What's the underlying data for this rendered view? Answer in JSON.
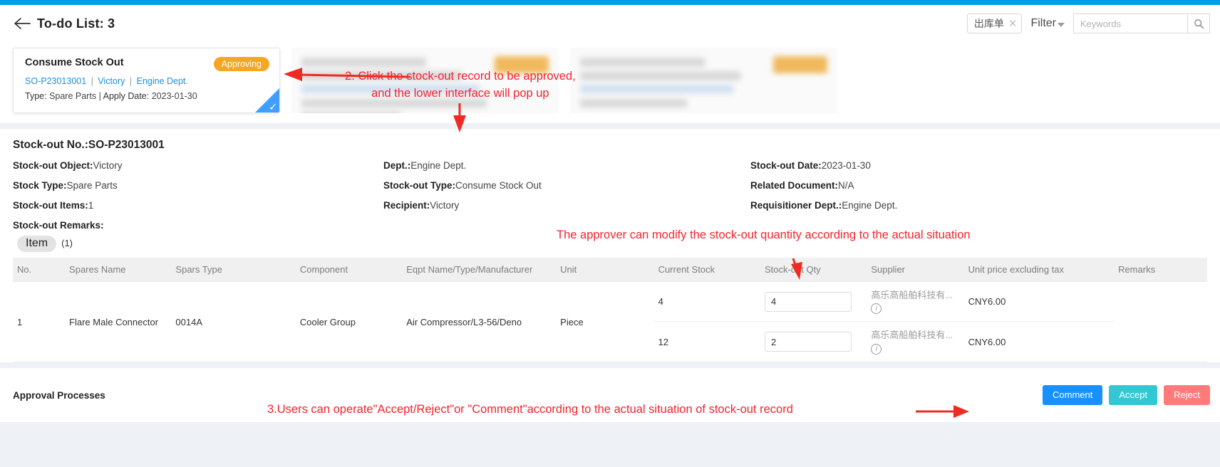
{
  "header": {
    "title": "To-do List: 3",
    "back_icon": "back-arrow-icon",
    "filter_tag": "出库单",
    "filter_tag_close": "✕",
    "filter_label": "Filter",
    "search_placeholder": "Keywords",
    "search_value": "",
    "search_icon": "search-icon"
  },
  "card": {
    "title": "Consume Stock Out",
    "badge": "Approving",
    "doc_no": "SO-P23013001",
    "vessel": "Victory",
    "dept": "Engine Dept.",
    "sep": "|",
    "meta_type_label": "Type:",
    "meta_type_value": "Spare Parts",
    "meta_sep": "|",
    "meta_date_label": "Apply Date:",
    "meta_date_value": "2023-01-30",
    "selected_icon": "check-icon"
  },
  "detail": {
    "title": "Stock-out No.:SO-P23013001",
    "fields": [
      {
        "key": "Stock-out Object:",
        "value": "Victory"
      },
      {
        "key": "Dept.:",
        "value": "Engine Dept."
      },
      {
        "key": "Stock-out Date:",
        "value": "2023-01-30"
      },
      {
        "key": "Stock Type:",
        "value": "Spare Parts"
      },
      {
        "key": "Stock-out Type:",
        "value": "Consume Stock Out"
      },
      {
        "key": "Related Document:",
        "value": "N/A"
      },
      {
        "key": "Stock-out Items:",
        "value": "1"
      },
      {
        "key": "Recipient:",
        "value": "Victory"
      },
      {
        "key": "Requisitioner Dept.:",
        "value": "Engine Dept."
      }
    ],
    "remarks_label": "Stock-out Remarks:",
    "tab_label": "Item",
    "tab_count": "(1)"
  },
  "table": {
    "columns": [
      "No.",
      "Spares Name",
      "Spars Type",
      "Component",
      "Eqpt Name/Type/Manufacturer",
      "Unit",
      "Current Stock",
      "Stock-out Qty",
      "Supplier",
      "Unit price excluding tax",
      "Remarks"
    ],
    "row": {
      "no": "1",
      "spares_name": "Flare Male Connector",
      "spars_type": "0014A",
      "component": "Cooler Group",
      "eqpt": "Air Compressor/L3-56/Deno",
      "unit": "Piece",
      "remarks": ""
    },
    "sub_rows": [
      {
        "current_stock": "4",
        "stockout_qty": "4",
        "supplier": "高乐高船舶科技有...",
        "supplier_info_icon": "info-icon",
        "price": "CNY6.00"
      },
      {
        "current_stock": "12",
        "stockout_qty": "2",
        "supplier": "高乐高船舶科技有...",
        "supplier_info_icon": "info-icon",
        "price": "CNY6.00"
      }
    ]
  },
  "approval": {
    "title": "Approval Processes",
    "comment_label": "Comment",
    "accept_label": "Accept",
    "reject_label": "Reject"
  },
  "annotations": {
    "step2_line1": "2. Click the stock-out record to be approved,",
    "step2_line2": "and the lower interface will pop up",
    "note_qty": "The approver can modify the stock-out quantity according to the actual situation",
    "step3": "3.Users can operate\"Accept/Reject\"or \"Comment\"according to the actual situation of stock-out record"
  },
  "colors": {
    "top_bar": "#00a0e9",
    "badge": "#f5a623",
    "link": "#1b8fe0",
    "annotation": "#f5222d",
    "comment": "#1890ff",
    "accept": "#33c7d4",
    "reject": "#ff7b7b"
  }
}
